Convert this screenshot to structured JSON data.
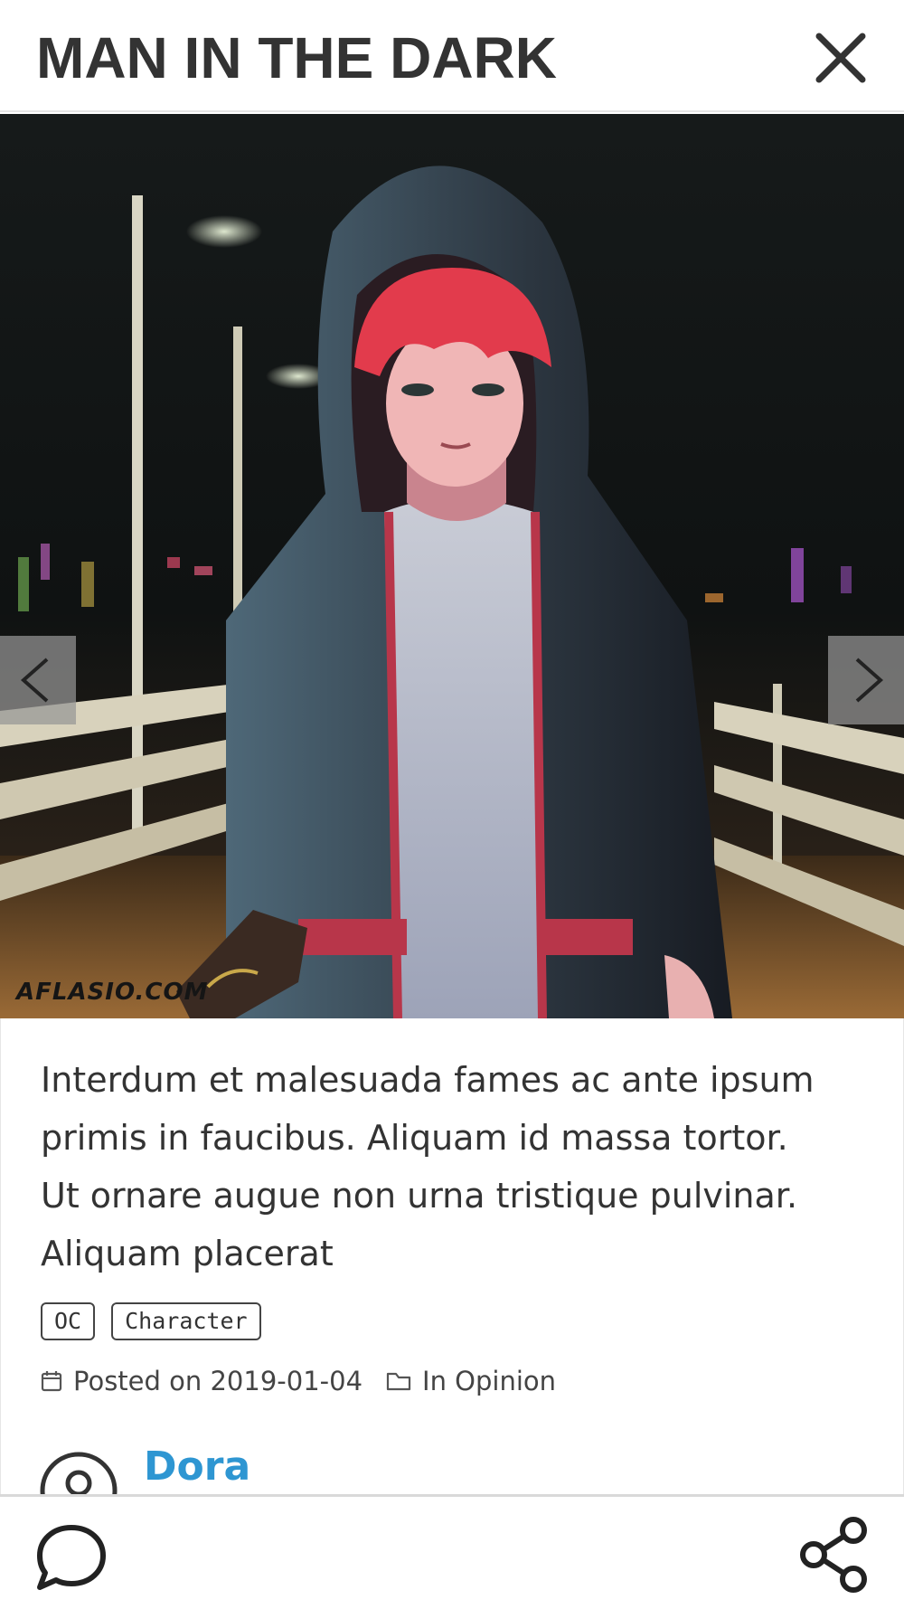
{
  "post": {
    "title": "MAN IN THE DARK",
    "watermark": "AFLASIO.COM",
    "description": "Interdum et malesuada fames ac ante ipsum primis in faucibus. Aliquam id massa tortor. Ut ornare augue non urna tristique pulvinar. Aliquam placerat",
    "tags": [
      "OC",
      "Character"
    ],
    "posted_on": "Posted on 2019-01-04",
    "category": "In Opinion",
    "author": "Dora"
  },
  "icons": {
    "close": "close-icon",
    "prev": "chevron-left-icon",
    "next": "chevron-right-icon",
    "calendar": "calendar-icon",
    "folder": "folder-icon",
    "avatar": "user-avatar-icon",
    "comment": "comment-icon",
    "share": "share-icon"
  },
  "colors": {
    "author_link": "#2e96d2",
    "text": "#333333",
    "background": "#ffffff"
  }
}
